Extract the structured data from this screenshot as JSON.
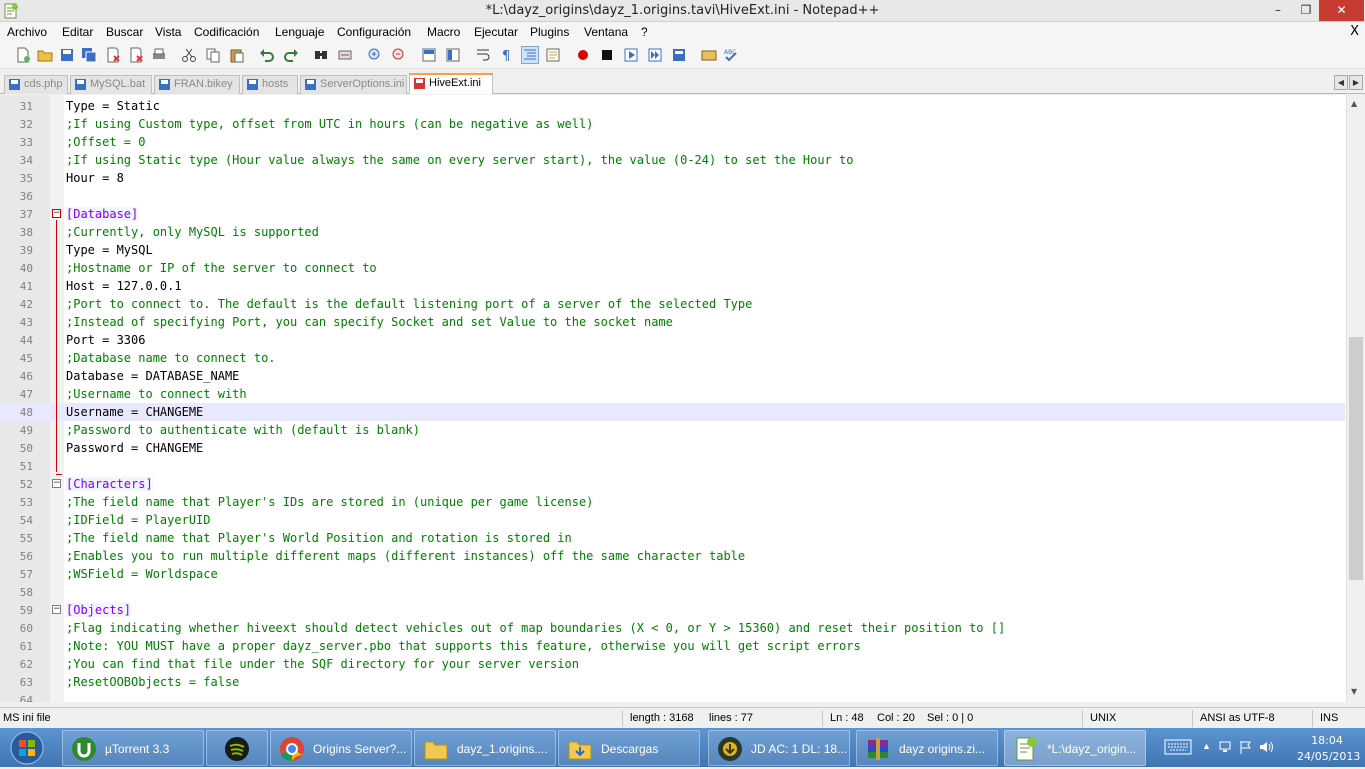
{
  "window": {
    "title": "*L:\\dayz_origins\\dayz_1.origins.tavi\\HiveExt.ini - Notepad++",
    "minimize": "–",
    "maximize": "❐",
    "close": "✕"
  },
  "menu": {
    "items": [
      "Archivo",
      "Editar",
      "Buscar",
      "Vista",
      "Codificación",
      "Lenguaje",
      "Configuración",
      "Macro",
      "Ejecutar",
      "Plugins",
      "Ventana",
      "?"
    ],
    "close": "X"
  },
  "tabs": [
    {
      "label": "cds.php",
      "active": false
    },
    {
      "label": "MySQL.bat",
      "active": false
    },
    {
      "label": "FRAN.bikey",
      "active": false
    },
    {
      "label": "hosts",
      "active": false
    },
    {
      "label": "ServerOptions.ini",
      "active": false
    },
    {
      "label": "HiveExt.ini",
      "active": true
    }
  ],
  "tab_nav": {
    "left": "◀",
    "right": "▶"
  },
  "editor": {
    "current_line": 48,
    "lines": [
      {
        "n": "31",
        "text": "Type = Static",
        "kind": "kv"
      },
      {
        "n": "32",
        "text": ";If using Custom type, offset from UTC in hours (can be negative as well)",
        "kind": "comment"
      },
      {
        "n": "33",
        "text": ";Offset = 0",
        "kind": "comment"
      },
      {
        "n": "34",
        "text": ";If using Static type (Hour value always the same on every server start), the value (0-24) to set the Hour to",
        "kind": "comment"
      },
      {
        "n": "35",
        "text": "Hour = 8",
        "kind": "kv"
      },
      {
        "n": "36",
        "text": "",
        "kind": "blank"
      },
      {
        "n": "37",
        "text": "[Database]",
        "kind": "section"
      },
      {
        "n": "38",
        "text": ";Currently, only MySQL is supported",
        "kind": "comment"
      },
      {
        "n": "39",
        "text": "Type = MySQL",
        "kind": "kv"
      },
      {
        "n": "40",
        "text": ";Hostname or IP of the server to connect to",
        "kind": "comment"
      },
      {
        "n": "41",
        "text": "Host = 127.0.0.1",
        "kind": "kv"
      },
      {
        "n": "42",
        "text": ";Port to connect to. The default is the default listening port of a server of the selected Type",
        "kind": "comment"
      },
      {
        "n": "43",
        "text": ";Instead of specifying Port, you can specify Socket and set Value to the socket name",
        "kind": "comment"
      },
      {
        "n": "44",
        "text": "Port = 3306",
        "kind": "kv"
      },
      {
        "n": "45",
        "text": ";Database name to connect to.",
        "kind": "comment"
      },
      {
        "n": "46",
        "text": "Database = DATABASE_NAME",
        "kind": "kv"
      },
      {
        "n": "47",
        "text": ";Username to connect with",
        "kind": "comment"
      },
      {
        "n": "48",
        "text": "Username = CHANGEME",
        "kind": "kv"
      },
      {
        "n": "49",
        "text": ";Password to authenticate with (default is blank)",
        "kind": "comment"
      },
      {
        "n": "50",
        "text": "Password = CHANGEME",
        "kind": "kv"
      },
      {
        "n": "51",
        "text": "",
        "kind": "blank"
      },
      {
        "n": "52",
        "text": "[Characters]",
        "kind": "section"
      },
      {
        "n": "53",
        "text": ";The field name that Player's IDs are stored in (unique per game license)",
        "kind": "comment"
      },
      {
        "n": "54",
        "text": ";IDField = PlayerUID",
        "kind": "comment"
      },
      {
        "n": "55",
        "text": ";The field name that Player's World Position and rotation is stored in",
        "kind": "comment"
      },
      {
        "n": "56",
        "text": ";Enables you to run multiple different maps (different instances) off the same character table",
        "kind": "comment"
      },
      {
        "n": "57",
        "text": ";WSField = Worldspace",
        "kind": "comment"
      },
      {
        "n": "58",
        "text": "",
        "kind": "blank"
      },
      {
        "n": "59",
        "text": "[Objects]",
        "kind": "section"
      },
      {
        "n": "60",
        "text": ";Flag indicating whether hiveext should detect vehicles out of map boundaries (X < 0, or Y > 15360) and reset their position to []",
        "kind": "comment"
      },
      {
        "n": "61",
        "text": ";Note: YOU MUST have a proper dayz_server.pbo that supports this feature, otherwise you will get script errors",
        "kind": "comment"
      },
      {
        "n": "62",
        "text": ";You can find that file under the SQF directory for your server version",
        "kind": "comment"
      },
      {
        "n": "63",
        "text": ";ResetOOBObjects = false",
        "kind": "comment"
      },
      {
        "n": "64",
        "text": "",
        "kind": "blank"
      }
    ]
  },
  "status": {
    "filetype": "MS ini file",
    "length": "length : 3168",
    "lines": "lines : 77",
    "ln": "Ln : 48",
    "col": "Col : 20",
    "sel": "Sel : 0 | 0",
    "eol": "UNIX",
    "encoding": "ANSI as UTF-8",
    "mode": "INS"
  },
  "taskbar": {
    "tasks": [
      {
        "label": "µTorrent 3.3",
        "icon": "utorrent-icon"
      },
      {
        "label": "",
        "icon": "spotify-icon"
      },
      {
        "label": "Origins Server?...",
        "icon": "chrome-icon"
      },
      {
        "label": "dayz_1.origins....",
        "icon": "folder-icon"
      },
      {
        "label": "Descargas",
        "icon": "downloads-folder-icon"
      },
      {
        "label": "JD AC: 1 DL: 18...",
        "icon": "jdownloader-icon"
      },
      {
        "label": "dayz origins.zi...",
        "icon": "winrar-icon"
      },
      {
        "label": "*L:\\dayz_origin...",
        "icon": "notepadpp-icon"
      }
    ],
    "clock_time": "18:04",
    "clock_date": "24/05/2013"
  },
  "colors": {
    "comment": "#008000",
    "section": "#8000ff",
    "current_line": "#e8e8ff",
    "tab_accent": "#f9a13b",
    "taskbar": "#4f86c6"
  }
}
